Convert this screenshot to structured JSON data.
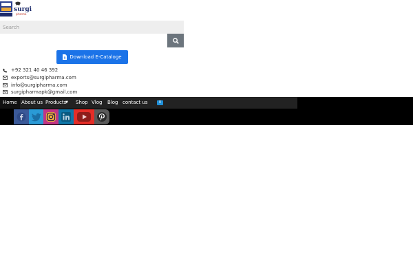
{
  "brand": {
    "logo_text": "surgi",
    "logo_subtext": "pharma"
  },
  "search": {
    "placeholder": "Search"
  },
  "catalogue": {
    "label": "Download E-Cataloge"
  },
  "contacts": {
    "phone": "+92 321 40 46 392",
    "email1": "exports@surgipharma.com",
    "email2": "info@surgipharma.com",
    "email3": "surgipharmapk@gmail.com"
  },
  "nav": {
    "home": "Home",
    "about": "About us",
    "products": "Products",
    "shop": "Shop",
    "vlog": "Vlog",
    "blog": "Blog",
    "contact": "contact us",
    "cart_count": "0"
  },
  "social": [
    "facebook-icon",
    "twitter-icon",
    "instagram-icon",
    "linkedin-icon",
    "youtube-icon",
    "pinterest-icon"
  ],
  "colors": {
    "accent": "#1b73e8",
    "nav_bg": "#000000",
    "search_btn": "#6c757d"
  }
}
